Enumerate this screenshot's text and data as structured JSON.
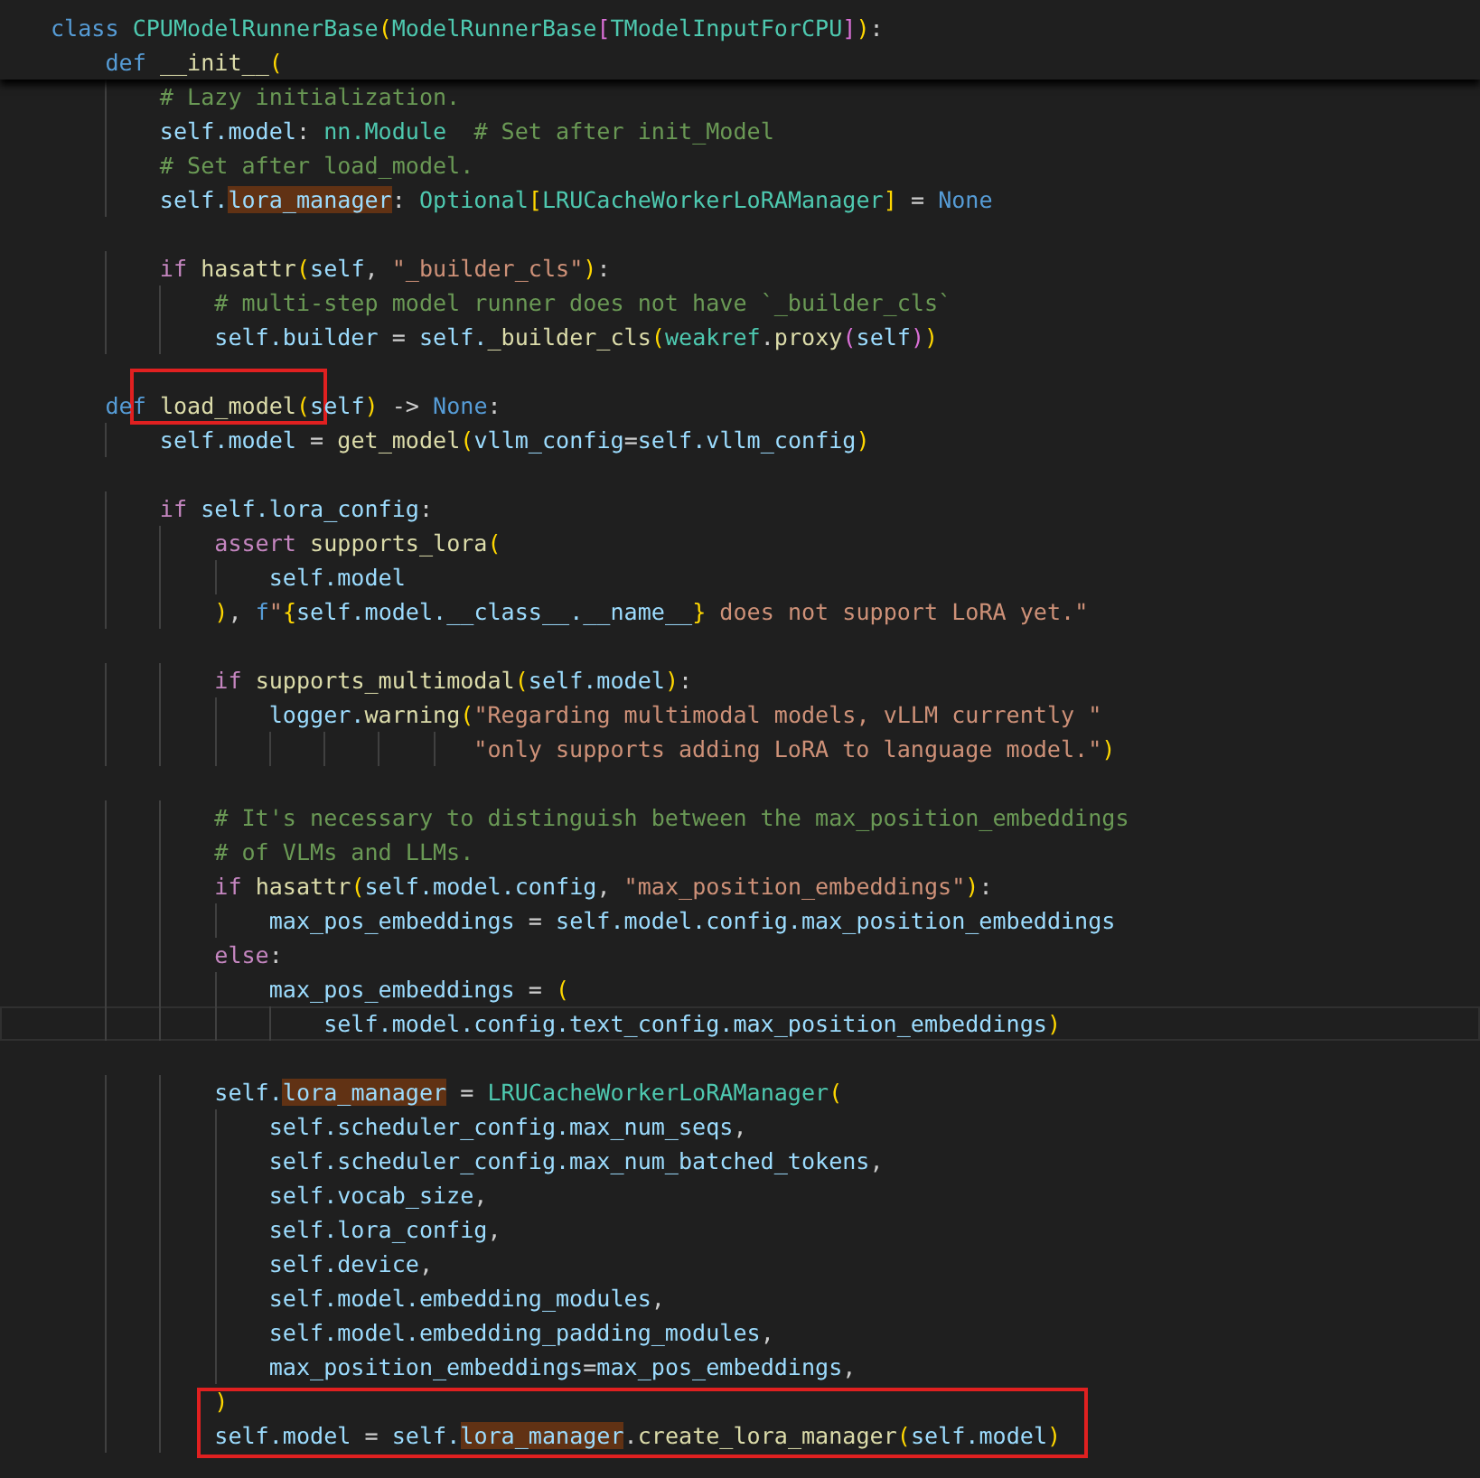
{
  "editor": {
    "sticky_lines": [
      {
        "kind": "code",
        "tokens": [
          {
            "kind": "kw",
            "text": "class "
          },
          {
            "kind": "type",
            "text": "CPUModelRunnerBase"
          },
          {
            "kind": "b1",
            "text": "("
          },
          {
            "kind": "type",
            "text": "ModelRunnerBase"
          },
          {
            "kind": "b2",
            "text": "["
          },
          {
            "kind": "type",
            "text": "TModelInputForCPU"
          },
          {
            "kind": "b2",
            "text": "]"
          },
          {
            "kind": "b1",
            "text": ")"
          },
          {
            "kind": "op",
            "text": ":"
          }
        ]
      },
      {
        "kind": "code",
        "tokens": [
          {
            "kind": "kw",
            "text": "    def "
          },
          {
            "kind": "fn",
            "text": "__init__"
          },
          {
            "kind": "b1",
            "text": "("
          }
        ]
      }
    ],
    "lines": [
      {
        "kind": "code",
        "tokens": [
          {
            "kind": "cmt",
            "text": "        # Lazy initialization."
          }
        ]
      },
      {
        "kind": "code",
        "tokens": [
          {
            "kind": "var",
            "text": "        self.model"
          },
          {
            "kind": "op",
            "text": ": "
          },
          {
            "kind": "type",
            "text": "nn.Module"
          },
          {
            "kind": "cmt",
            "text": "  # Set after init_Model"
          }
        ]
      },
      {
        "kind": "code",
        "tokens": [
          {
            "kind": "cmt",
            "text": "        # Set after load_model."
          }
        ]
      },
      {
        "kind": "code",
        "tokens": [
          {
            "kind": "var",
            "text": "        self."
          },
          {
            "kind": "hl",
            "text": "lora_manager"
          },
          {
            "kind": "op",
            "text": ": "
          },
          {
            "kind": "type",
            "text": "Optional"
          },
          {
            "kind": "b1",
            "text": "["
          },
          {
            "kind": "type",
            "text": "LRUCacheWorkerLoRAManager"
          },
          {
            "kind": "b1",
            "text": "]"
          },
          {
            "kind": "op",
            "text": " = "
          },
          {
            "kind": "kw",
            "text": "None"
          }
        ]
      },
      {
        "kind": "blank"
      },
      {
        "kind": "code",
        "tokens": [
          {
            "kind": "ctl",
            "text": "        if "
          },
          {
            "kind": "fn",
            "text": "hasattr"
          },
          {
            "kind": "b1",
            "text": "("
          },
          {
            "kind": "var",
            "text": "self"
          },
          {
            "kind": "op",
            "text": ", "
          },
          {
            "kind": "str",
            "text": "\"_builder_cls\""
          },
          {
            "kind": "b1",
            "text": ")"
          },
          {
            "kind": "op",
            "text": ":"
          }
        ]
      },
      {
        "kind": "code",
        "tokens": [
          {
            "kind": "cmt",
            "text": "            # multi-step model runner does not have `_builder_cls`"
          }
        ]
      },
      {
        "kind": "code",
        "tokens": [
          {
            "kind": "var",
            "text": "            self.builder"
          },
          {
            "kind": "op",
            "text": " = "
          },
          {
            "kind": "var",
            "text": "self."
          },
          {
            "kind": "fn",
            "text": "_builder_cls"
          },
          {
            "kind": "b1",
            "text": "("
          },
          {
            "kind": "type",
            "text": "weakref"
          },
          {
            "kind": "op",
            "text": "."
          },
          {
            "kind": "fn",
            "text": "proxy"
          },
          {
            "kind": "b2",
            "text": "("
          },
          {
            "kind": "var",
            "text": "self"
          },
          {
            "kind": "b2",
            "text": ")"
          },
          {
            "kind": "b1",
            "text": ")"
          }
        ]
      },
      {
        "kind": "blank"
      },
      {
        "kind": "code",
        "tokens": [
          {
            "kind": "kw",
            "text": "    def "
          },
          {
            "kind": "fn",
            "text": "load_model",
            "boxed": true
          },
          {
            "kind": "b1",
            "text": "("
          },
          {
            "kind": "var",
            "text": "self"
          },
          {
            "kind": "b1",
            "text": ")"
          },
          {
            "kind": "op",
            "text": " -> "
          },
          {
            "kind": "kw",
            "text": "None"
          },
          {
            "kind": "op",
            "text": ":"
          }
        ]
      },
      {
        "kind": "code",
        "tokens": [
          {
            "kind": "var",
            "text": "        self.model"
          },
          {
            "kind": "op",
            "text": " = "
          },
          {
            "kind": "fn",
            "text": "get_model"
          },
          {
            "kind": "b1",
            "text": "("
          },
          {
            "kind": "var",
            "text": "vllm_config"
          },
          {
            "kind": "op",
            "text": "="
          },
          {
            "kind": "var",
            "text": "self.vllm_config"
          },
          {
            "kind": "b1",
            "text": ")"
          }
        ]
      },
      {
        "kind": "blank"
      },
      {
        "kind": "code",
        "tokens": [
          {
            "kind": "ctl",
            "text": "        if "
          },
          {
            "kind": "var",
            "text": "self.lora_config"
          },
          {
            "kind": "op",
            "text": ":"
          }
        ]
      },
      {
        "kind": "code",
        "tokens": [
          {
            "kind": "ctl",
            "text": "            assert "
          },
          {
            "kind": "fn",
            "text": "supports_lora"
          },
          {
            "kind": "b1",
            "text": "("
          }
        ]
      },
      {
        "kind": "code",
        "tokens": [
          {
            "kind": "var",
            "text": "                self.model"
          }
        ]
      },
      {
        "kind": "code",
        "tokens": [
          {
            "kind": "b1",
            "text": "            )"
          },
          {
            "kind": "op",
            "text": ", "
          },
          {
            "kind": "kw",
            "text": "f"
          },
          {
            "kind": "str",
            "text": "\""
          },
          {
            "kind": "b1",
            "text": "{"
          },
          {
            "kind": "var",
            "text": "self.model.__class__.__name__"
          },
          {
            "kind": "b1",
            "text": "}"
          },
          {
            "kind": "str",
            "text": " does not support LoRA yet.\""
          }
        ]
      },
      {
        "kind": "blank"
      },
      {
        "kind": "code",
        "tokens": [
          {
            "kind": "ctl",
            "text": "            if "
          },
          {
            "kind": "fn",
            "text": "supports_multimodal"
          },
          {
            "kind": "b1",
            "text": "("
          },
          {
            "kind": "var",
            "text": "self.model"
          },
          {
            "kind": "b1",
            "text": ")"
          },
          {
            "kind": "op",
            "text": ":"
          }
        ]
      },
      {
        "kind": "code",
        "tokens": [
          {
            "kind": "var",
            "text": "                logger."
          },
          {
            "kind": "fn",
            "text": "warning"
          },
          {
            "kind": "b1",
            "text": "("
          },
          {
            "kind": "str",
            "text": "\"Regarding multimodal models, vLLM currently \""
          }
        ]
      },
      {
        "kind": "code",
        "tokens": [
          {
            "kind": "str",
            "text": "                               \"only supports adding LoRA to language model.\""
          },
          {
            "kind": "b1",
            "text": ")"
          }
        ]
      },
      {
        "kind": "blank"
      },
      {
        "kind": "code",
        "tokens": [
          {
            "kind": "cmt",
            "text": "            # It's necessary to distinguish between the max_position_embeddings"
          }
        ]
      },
      {
        "kind": "code",
        "tokens": [
          {
            "kind": "cmt",
            "text": "            # of VLMs and LLMs."
          }
        ]
      },
      {
        "kind": "code",
        "tokens": [
          {
            "kind": "ctl",
            "text": "            if "
          },
          {
            "kind": "fn",
            "text": "hasattr"
          },
          {
            "kind": "b1",
            "text": "("
          },
          {
            "kind": "var",
            "text": "self.model.config"
          },
          {
            "kind": "op",
            "text": ", "
          },
          {
            "kind": "str",
            "text": "\"max_position_embeddings\""
          },
          {
            "kind": "b1",
            "text": ")"
          },
          {
            "kind": "op",
            "text": ":"
          }
        ]
      },
      {
        "kind": "code",
        "tokens": [
          {
            "kind": "var",
            "text": "                max_pos_embeddings"
          },
          {
            "kind": "op",
            "text": " = "
          },
          {
            "kind": "var",
            "text": "self.model.config.max_position_embeddings"
          }
        ]
      },
      {
        "kind": "code",
        "tokens": [
          {
            "kind": "ctl",
            "text": "            else"
          },
          {
            "kind": "op",
            "text": ":"
          }
        ]
      },
      {
        "kind": "code",
        "tokens": [
          {
            "kind": "var",
            "text": "                max_pos_embeddings"
          },
          {
            "kind": "op",
            "text": " = "
          },
          {
            "kind": "b1",
            "text": "("
          }
        ]
      },
      {
        "kind": "current",
        "tokens": [
          {
            "kind": "var",
            "text": "                    self.model.config.text_config.max_position_embeddings"
          },
          {
            "kind": "b1",
            "text": ")"
          }
        ]
      },
      {
        "kind": "blank"
      },
      {
        "kind": "code",
        "tokens": [
          {
            "kind": "var",
            "text": "            self."
          },
          {
            "kind": "hl",
            "text": "lora_manager"
          },
          {
            "kind": "op",
            "text": " = "
          },
          {
            "kind": "type",
            "text": "LRUCacheWorkerLoRAManager"
          },
          {
            "kind": "b1",
            "text": "("
          }
        ]
      },
      {
        "kind": "code",
        "tokens": [
          {
            "kind": "var",
            "text": "                self.scheduler_config.max_num_seqs"
          },
          {
            "kind": "op",
            "text": ","
          }
        ]
      },
      {
        "kind": "code",
        "tokens": [
          {
            "kind": "var",
            "text": "                self.scheduler_config.max_num_batched_tokens"
          },
          {
            "kind": "op",
            "text": ","
          }
        ]
      },
      {
        "kind": "code",
        "tokens": [
          {
            "kind": "var",
            "text": "                self.vocab_size"
          },
          {
            "kind": "op",
            "text": ","
          }
        ]
      },
      {
        "kind": "code",
        "tokens": [
          {
            "kind": "var",
            "text": "                self.lora_config"
          },
          {
            "kind": "op",
            "text": ","
          }
        ]
      },
      {
        "kind": "code",
        "tokens": [
          {
            "kind": "var",
            "text": "                self.device"
          },
          {
            "kind": "op",
            "text": ","
          }
        ]
      },
      {
        "kind": "code",
        "tokens": [
          {
            "kind": "var",
            "text": "                self.model.embedding_modules"
          },
          {
            "kind": "op",
            "text": ","
          }
        ]
      },
      {
        "kind": "code",
        "tokens": [
          {
            "kind": "var",
            "text": "                self.model.embedding_padding_modules"
          },
          {
            "kind": "op",
            "text": ","
          }
        ]
      },
      {
        "kind": "code",
        "tokens": [
          {
            "kind": "var",
            "text": "                max_position_embeddings"
          },
          {
            "kind": "op",
            "text": "="
          },
          {
            "kind": "var",
            "text": "max_pos_embeddings"
          },
          {
            "kind": "op",
            "text": ","
          }
        ]
      },
      {
        "kind": "boxed_group",
        "lines": [
          {
            "kind": "code",
            "tokens": [
              {
                "kind": "b1",
                "text": "            )"
              }
            ]
          },
          {
            "kind": "code",
            "tokens": [
              {
                "kind": "var",
                "text": "            self.model"
              },
              {
                "kind": "op",
                "text": " = "
              },
              {
                "kind": "var",
                "text": "self."
              },
              {
                "kind": "hl",
                "text": "lora_manager"
              },
              {
                "kind": "op",
                "text": "."
              },
              {
                "kind": "fn",
                "text": "create_lora_manager"
              },
              {
                "kind": "b1",
                "text": "("
              },
              {
                "kind": "var",
                "text": "self.model"
              },
              {
                "kind": "b1",
                "text": ")"
              }
            ]
          }
        ]
      }
    ]
  }
}
